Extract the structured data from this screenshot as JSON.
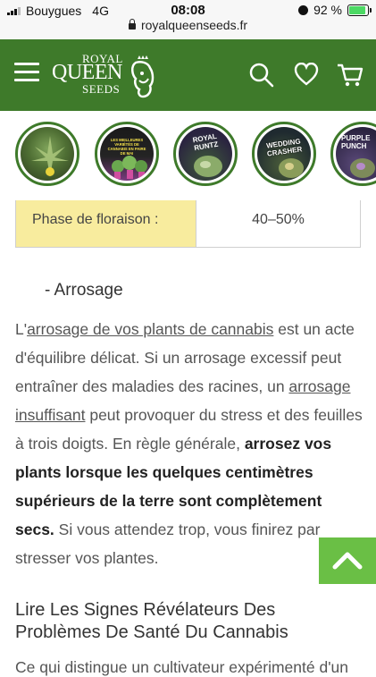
{
  "status_bar": {
    "carrier": "Bouygues",
    "network": "4G",
    "time": "08:08",
    "battery": "92 %",
    "battery_level": 0.92
  },
  "url_bar": {
    "domain": "royalqueenseeds.fr"
  },
  "header": {
    "logo_line1": "ROYAL",
    "logo_line2": "QUEEN",
    "logo_line3": "SEEDS",
    "brand_color": "#3e7a2a"
  },
  "stories": [
    {
      "icon": "cannabis-plant",
      "text": ""
    },
    {
      "icon": "plants-banner",
      "text": "LES MEILLEURES VARIÉTÉS DE CANNABIS EN PAIRE DE MAI"
    },
    {
      "icon": "royal-runtz",
      "text": "ROYAL RUNTZ"
    },
    {
      "icon": "wedding-crasher",
      "text": "WEDDING CRASHER"
    },
    {
      "icon": "purple-punch",
      "text": "PURPLE PUNCH"
    }
  ],
  "table": {
    "label": "Phase de floraison :",
    "value": "40–50%"
  },
  "article": {
    "subheading": "- Arrosage",
    "p1_pre": "L'",
    "p1_link1": "arrosage de vos plants de cannabis",
    "p1_mid1": " est un acte d'équilibre délicat. Si un arrosage excessif peut entraîner des maladies des racines, un ",
    "p1_link2": "arrosage insuffisant",
    "p1_mid2": " peut provoquer du stress et des feuilles à trois doigts. En règle générale, ",
    "p1_bold": "arrosez vos plants lorsque les quelques centimètres supérieurs de la terre sont complètement secs.",
    "p1_end": " Si vous attendez trop, vous finirez par stresser vos plantes.",
    "heading2": "Lire Les Signes Révélateurs Des Problèmes De Santé Du Cannabis",
    "next_line": "Ce qui distingue un cultivateur expérimenté d'un"
  },
  "colors": {
    "accent_green": "#6abf45",
    "highlight_yellow": "#f8ec9e"
  }
}
